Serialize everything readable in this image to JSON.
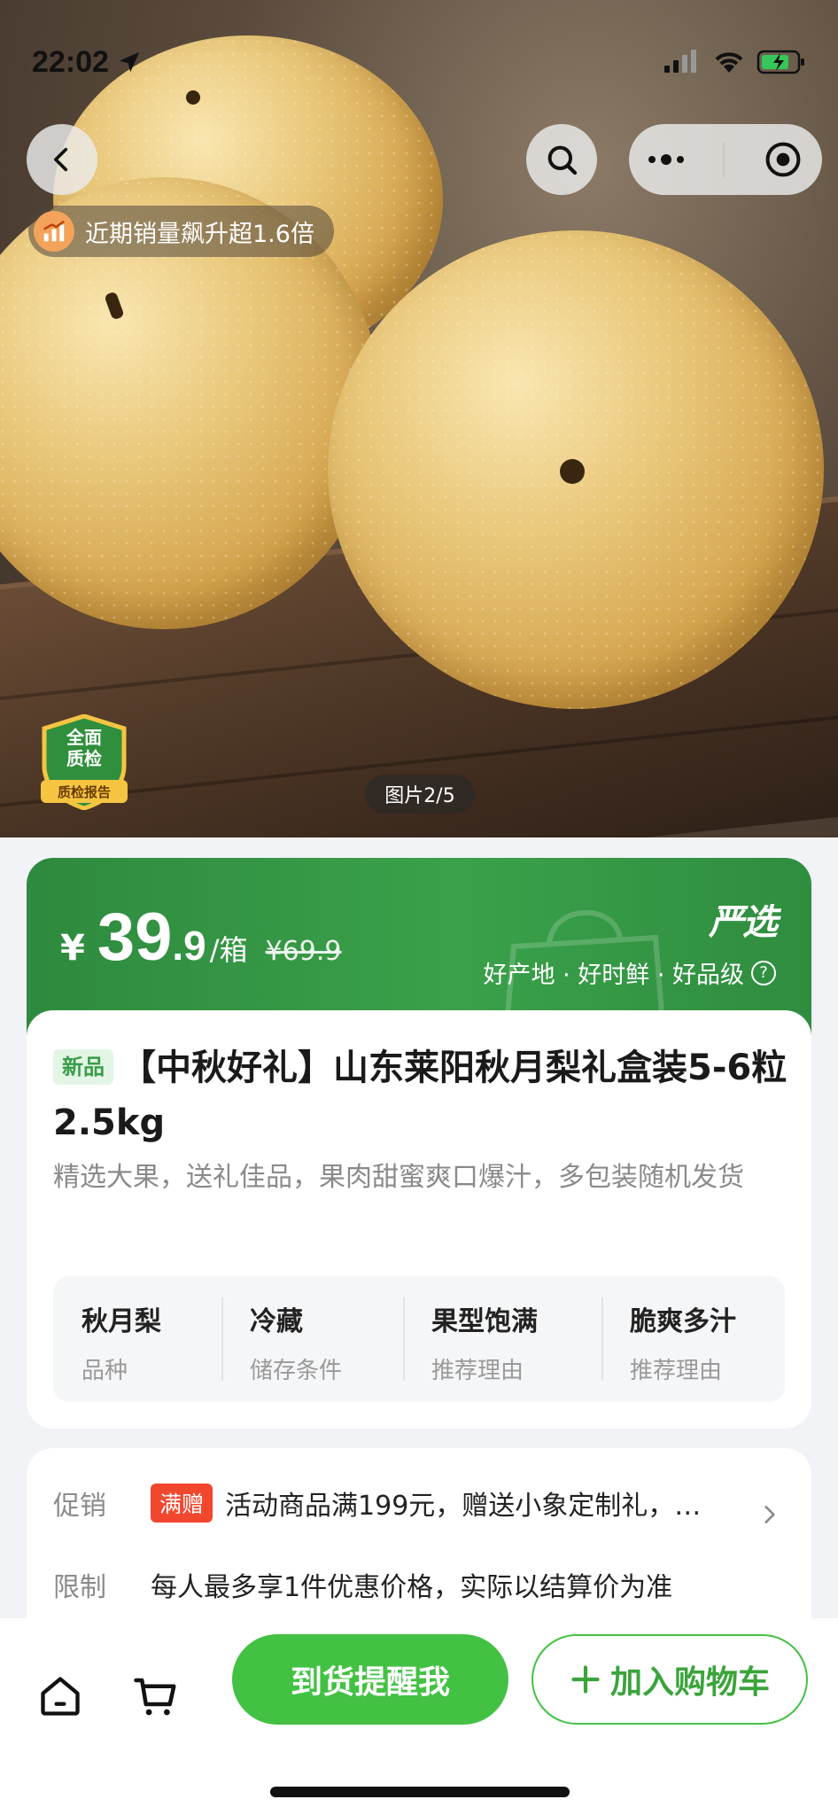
{
  "status_bar": {
    "time": "22:02"
  },
  "hero": {
    "sales_badge": "近期销量飙升超1.6倍",
    "qc_badge": {
      "line1": "全面",
      "line2": "质检",
      "line3": "质检报告"
    },
    "image_counter": "图片2/5"
  },
  "price": {
    "currency": "¥",
    "integer": "39",
    "decimal": ".9",
    "unit": "/箱",
    "original": "¥69.9",
    "brand": "严选",
    "tagline": "好产地 · 好时鲜 · 好品级"
  },
  "product": {
    "new_tag": "新品",
    "title": "【中秋好礼】山东莱阳秋月梨礼盒装5-6粒2.5kg",
    "subtitle": "精选大果，送礼佳品，果肉甜蜜爽口爆汁，多包装随机发货",
    "attributes": [
      {
        "value": "秋月梨",
        "key": "品种"
      },
      {
        "value": "冷藏",
        "key": "储存条件"
      },
      {
        "value": "果型饱满",
        "key": "推荐理由"
      },
      {
        "value": "脆爽多汁",
        "key": "推荐理由"
      }
    ]
  },
  "promo": {
    "promo_label": "促销",
    "promo_tag": "满赠",
    "promo_text": "活动商品满199元，赠送小象定制礼，…",
    "limit_label": "限制",
    "limit_text": "每人最多享1件优惠价格，实际以结算价为准"
  },
  "bottom_bar": {
    "remind_label": "到货提醒我",
    "add_cart_label": "加入购物车"
  },
  "colors": {
    "brand_green": "#43c143",
    "banner_green": "#3aa14a",
    "promo_red": "#f2472f"
  }
}
